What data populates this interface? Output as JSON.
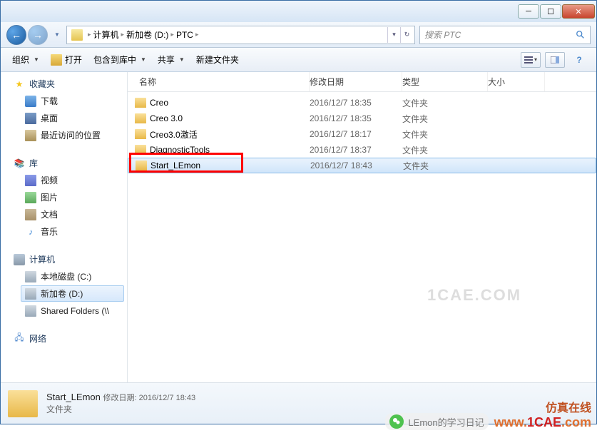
{
  "breadcrumb": {
    "computer": "计算机",
    "drive": "新加卷 (D:)",
    "folder": "PTC"
  },
  "search": {
    "placeholder": "搜索 PTC"
  },
  "toolbar": {
    "organize": "组织",
    "open": "打开",
    "include": "包含到库中",
    "share": "共享",
    "newfolder": "新建文件夹"
  },
  "sidebar": {
    "favorites": "收藏夹",
    "downloads": "下载",
    "desktop": "桌面",
    "recent": "最近访问的位置",
    "library": "库",
    "video": "视频",
    "pictures": "图片",
    "documents": "文档",
    "music": "音乐",
    "computer": "计算机",
    "cdrive": "本地磁盘 (C:)",
    "ddrive": "新加卷 (D:)",
    "shared": "Shared Folders (\\\\",
    "network": "网络"
  },
  "columns": {
    "name": "名称",
    "date": "修改日期",
    "type": "类型",
    "size": "大小"
  },
  "files": [
    {
      "name": "Creo",
      "date": "2016/12/7 18:35",
      "type": "文件夹"
    },
    {
      "name": "Creo 3.0",
      "date": "2016/12/7 18:35",
      "type": "文件夹"
    },
    {
      "name": "Creo3.0激活",
      "date": "2016/12/7 18:17",
      "type": "文件夹"
    },
    {
      "name": "DiagnosticTools",
      "date": "2016/12/7 18:37",
      "type": "文件夹"
    },
    {
      "name": "Start_LEmon",
      "date": "2016/12/7 18:43",
      "type": "文件夹"
    }
  ],
  "details": {
    "name": "Start_LEmon",
    "modlabel": "修改日期:",
    "moddate": "2016/12/7 18:43",
    "type": "文件夹"
  },
  "watermark": "1CAE.COM",
  "overlay": {
    "wechat": "LEmon的学习日记",
    "brand": "仿真在线",
    "url": "www.1CAE.com"
  }
}
